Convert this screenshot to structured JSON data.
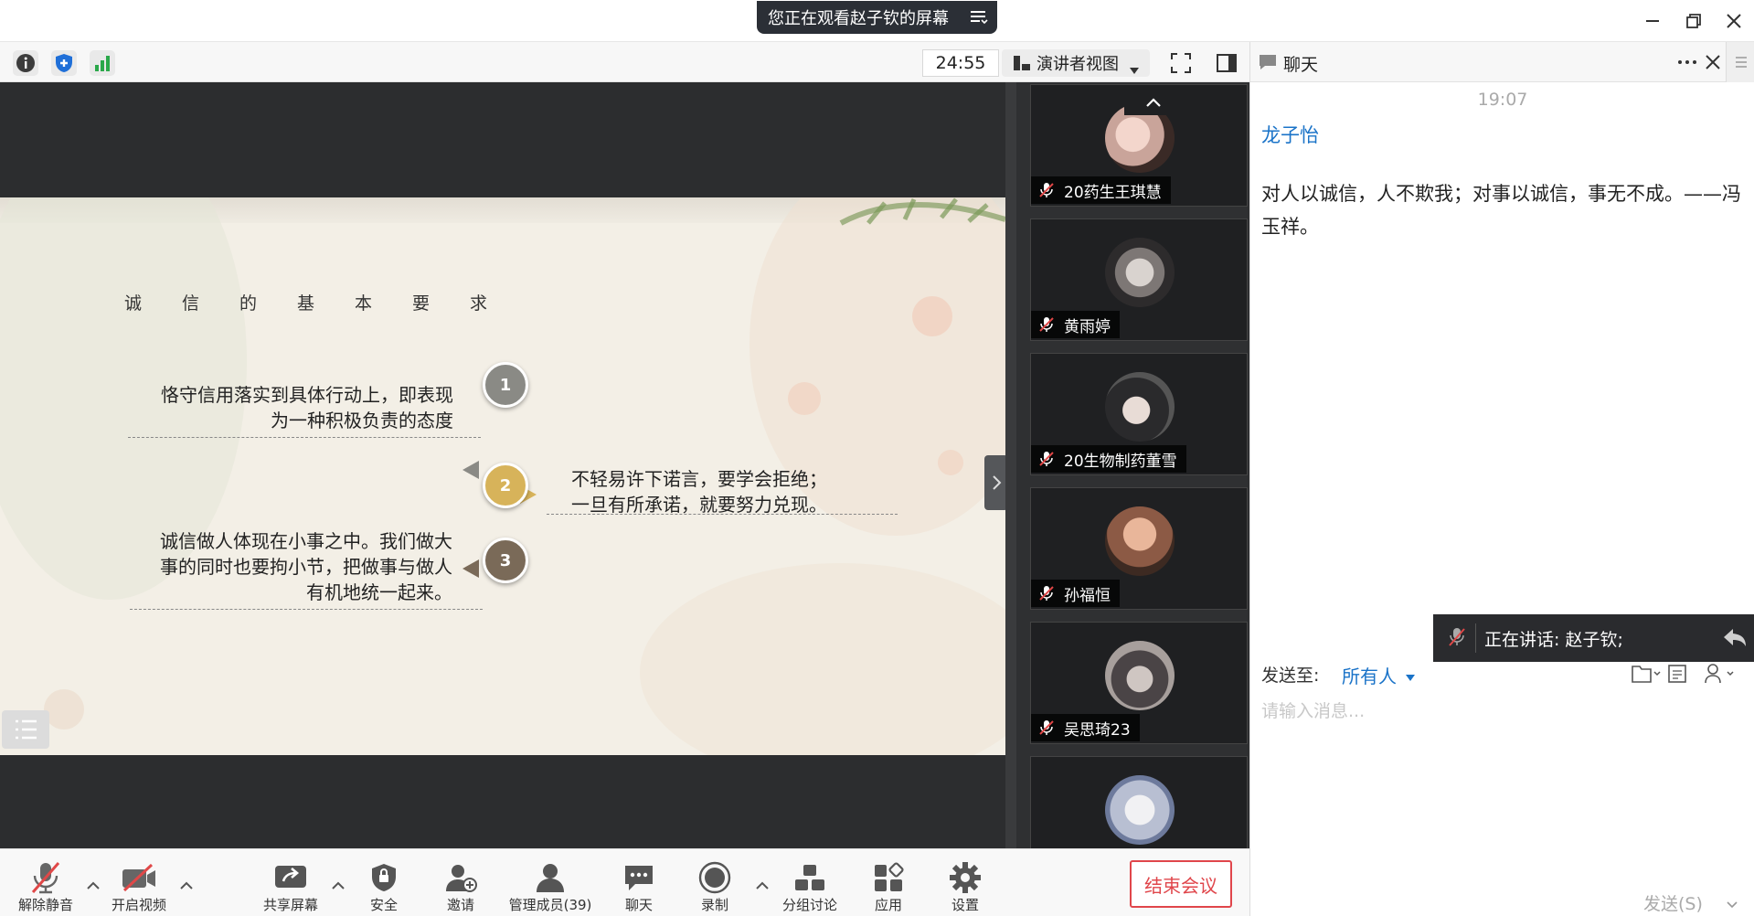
{
  "window": {
    "share_banner": "您正在观看赵子钦的屏幕",
    "controls": [
      "minimize-icon",
      "restore-icon",
      "close-icon"
    ]
  },
  "toolbar": {
    "timer": "24:55",
    "view_mode": "演讲者视图",
    "icons": [
      "info-icon",
      "shield-icon",
      "signal-icon",
      "fullscreen-icon",
      "panel-toggle-icon"
    ]
  },
  "slide": {
    "title": "诚信的基本要求",
    "points": [
      {
        "number": "1",
        "text_line1": "恪守信用落实到具体行动上，即表现",
        "text_line2": "为一种积极负责的态度",
        "color": "#8a8a85"
      },
      {
        "number": "2",
        "text_line1": "不轻易许下诺言，要学会拒绝；",
        "text_line2": "一旦有所承诺，就要努力兑现。",
        "color": "#d7b35a"
      },
      {
        "number": "3",
        "text_line1": "诚信做人体现在小事之中。我们做大",
        "text_line2": "事的同时也要拘小节，把做事与做人",
        "text_line3": "有机地统一起来。",
        "color": "#7a6a58"
      }
    ]
  },
  "participants": [
    {
      "name": "20药生王琪慧"
    },
    {
      "name": "黄雨婷"
    },
    {
      "name": "20生物制药董雪"
    },
    {
      "name": "孙福恒"
    },
    {
      "name": "吴思琦23"
    },
    {
      "name": ""
    }
  ],
  "chat": {
    "title": "聊天",
    "time": "19:07",
    "sender": "龙子怡",
    "message": "对人以诚信，人不欺我；对事以诚信，事无不成。——冯玉祥。",
    "speaking": "正在讲话: 赵子钦;",
    "send_to_label": "发送至:",
    "send_to_value": "所有人",
    "input_placeholder": "请输入消息...",
    "send_button": "发送(S)"
  },
  "controls": [
    {
      "label": "解除静音"
    },
    {
      "label": "开启视频"
    },
    {
      "label": "共享屏幕"
    },
    {
      "label": "安全"
    },
    {
      "label": "邀请"
    },
    {
      "label": "管理成员(39)"
    },
    {
      "label": "聊天"
    },
    {
      "label": "录制"
    },
    {
      "label": "分组讨论"
    },
    {
      "label": "应用"
    },
    {
      "label": "设置"
    }
  ],
  "end_meeting": "结束会议",
  "colors": {
    "accent": "#1a73c8",
    "danger": "#e0464b",
    "stage": "#2c2d2f"
  }
}
